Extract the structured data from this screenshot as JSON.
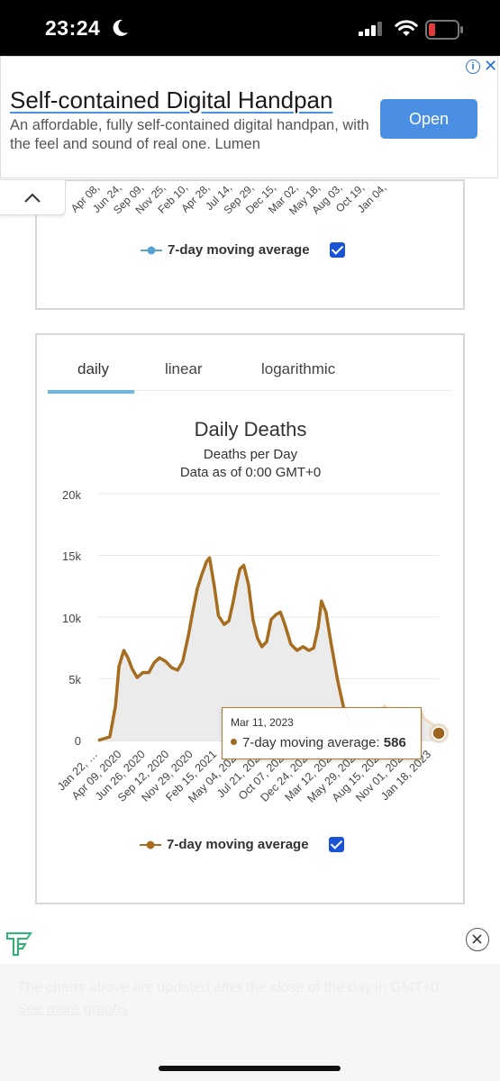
{
  "status": {
    "time": "23:24"
  },
  "ad": {
    "title": "Self-contained Digital Handpan",
    "description": "An affordable, fully self-contained digital handpan, with the feel and sound of real one. Lumen",
    "open_label": "Open",
    "info_glyph": "i",
    "close_glyph": "✕"
  },
  "top_chart": {
    "x_ticks": [
      "Apr 08,",
      "Jun 24,",
      "Sep 09,",
      "Nov 25,",
      "Feb 10,",
      "Apr 28,",
      "Jul 14,",
      "Sep 29,",
      "Dec 15,",
      "Mar 02,",
      "May 18,",
      "Aug 03,",
      "Oct 19,",
      "Jan 04,"
    ],
    "legend_label": "7-day moving average",
    "legend_color": "#5aa3d0"
  },
  "deaths_chart": {
    "tabs": [
      "daily",
      "linear",
      "logarithmic"
    ],
    "active_tab": "daily",
    "title": "Daily Deaths",
    "subtitle": "Deaths per Day",
    "subtitle2": "Data as of 0:00 GMT+0",
    "legend_label": "7-day moving average",
    "line_color": "#a66d1f",
    "tooltip": {
      "date": "Mar 11, 2023",
      "label": "7-day moving average: ",
      "value": "586"
    }
  },
  "chart_data": {
    "type": "area",
    "title": "Daily Deaths",
    "subtitle": "Deaths per Day",
    "ylim": [
      0,
      20000
    ],
    "y_ticks": [
      {
        "value": 0,
        "label": "0"
      },
      {
        "value": 5000,
        "label": "5k"
      },
      {
        "value": 10000,
        "label": "10k"
      },
      {
        "value": 15000,
        "label": "15k"
      },
      {
        "value": 20000,
        "label": "20k"
      }
    ],
    "x_ticks": [
      "Jan 22, …",
      "Apr 09, 2020",
      "Jun 26, 2020",
      "Sep 12, 2020",
      "Nov 29, 2020",
      "Feb 15, 2021",
      "May 04, 2021",
      "Jul 21, 2021",
      "Oct 07, 2021",
      "Dec 24, 2021",
      "Mar 12, 2022",
      "May 29, 2022",
      "Aug 15, 2022",
      "Nov 01, 2022",
      "Jan 18, 2023"
    ],
    "series": [
      {
        "name": "7-day moving average",
        "x": [
          "2020-01-22",
          "2020-03-01",
          "2020-03-20",
          "2020-04-01",
          "2020-04-17",
          "2020-05-01",
          "2020-05-15",
          "2020-06-01",
          "2020-06-20",
          "2020-07-10",
          "2020-07-28",
          "2020-08-15",
          "2020-09-05",
          "2020-09-25",
          "2020-10-15",
          "2020-11-01",
          "2020-11-20",
          "2020-12-05",
          "2020-12-20",
          "2021-01-05",
          "2021-01-20",
          "2021-01-30",
          "2021-02-15",
          "2021-03-01",
          "2021-03-20",
          "2021-04-05",
          "2021-04-20",
          "2021-05-01",
          "2021-05-12",
          "2021-05-25",
          "2021-06-10",
          "2021-06-25",
          "2021-07-10",
          "2021-07-25",
          "2021-08-10",
          "2021-08-25",
          "2021-09-10",
          "2021-09-25",
          "2021-10-10",
          "2021-10-30",
          "2021-11-20",
          "2021-12-10",
          "2021-12-30",
          "2022-01-15",
          "2022-01-30",
          "2022-02-10",
          "2022-02-25",
          "2022-03-15",
          "2022-04-05",
          "2022-04-25",
          "2022-05-15",
          "2022-06-05",
          "2022-06-25",
          "2022-07-15",
          "2022-08-01",
          "2022-08-20",
          "2022-09-10",
          "2022-10-01",
          "2022-10-20",
          "2022-11-10",
          "2022-12-01",
          "2022-12-20",
          "2023-01-05",
          "2023-01-20",
          "2023-02-05",
          "2023-02-20",
          "2023-03-11"
        ],
        "values": [
          0,
          300,
          2800,
          6000,
          7300,
          6700,
          5800,
          5100,
          5500,
          5500,
          6300,
          6700,
          6400,
          5900,
          5700,
          6400,
          8500,
          10500,
          12300,
          13500,
          14500,
          14800,
          12500,
          10100,
          9400,
          9700,
          11300,
          12700,
          13900,
          14200,
          12600,
          9800,
          8300,
          7600,
          8000,
          9800,
          10200,
          10400,
          9400,
          7800,
          7300,
          7600,
          7300,
          7500,
          9200,
          11300,
          10400,
          7800,
          4900,
          2700,
          1600,
          1400,
          1700,
          1300,
          1400,
          2200,
          2800,
          2200,
          1600,
          1300,
          1800,
          2400,
          2600,
          1800,
          1500,
          1300,
          586
        ]
      }
    ]
  }
}
